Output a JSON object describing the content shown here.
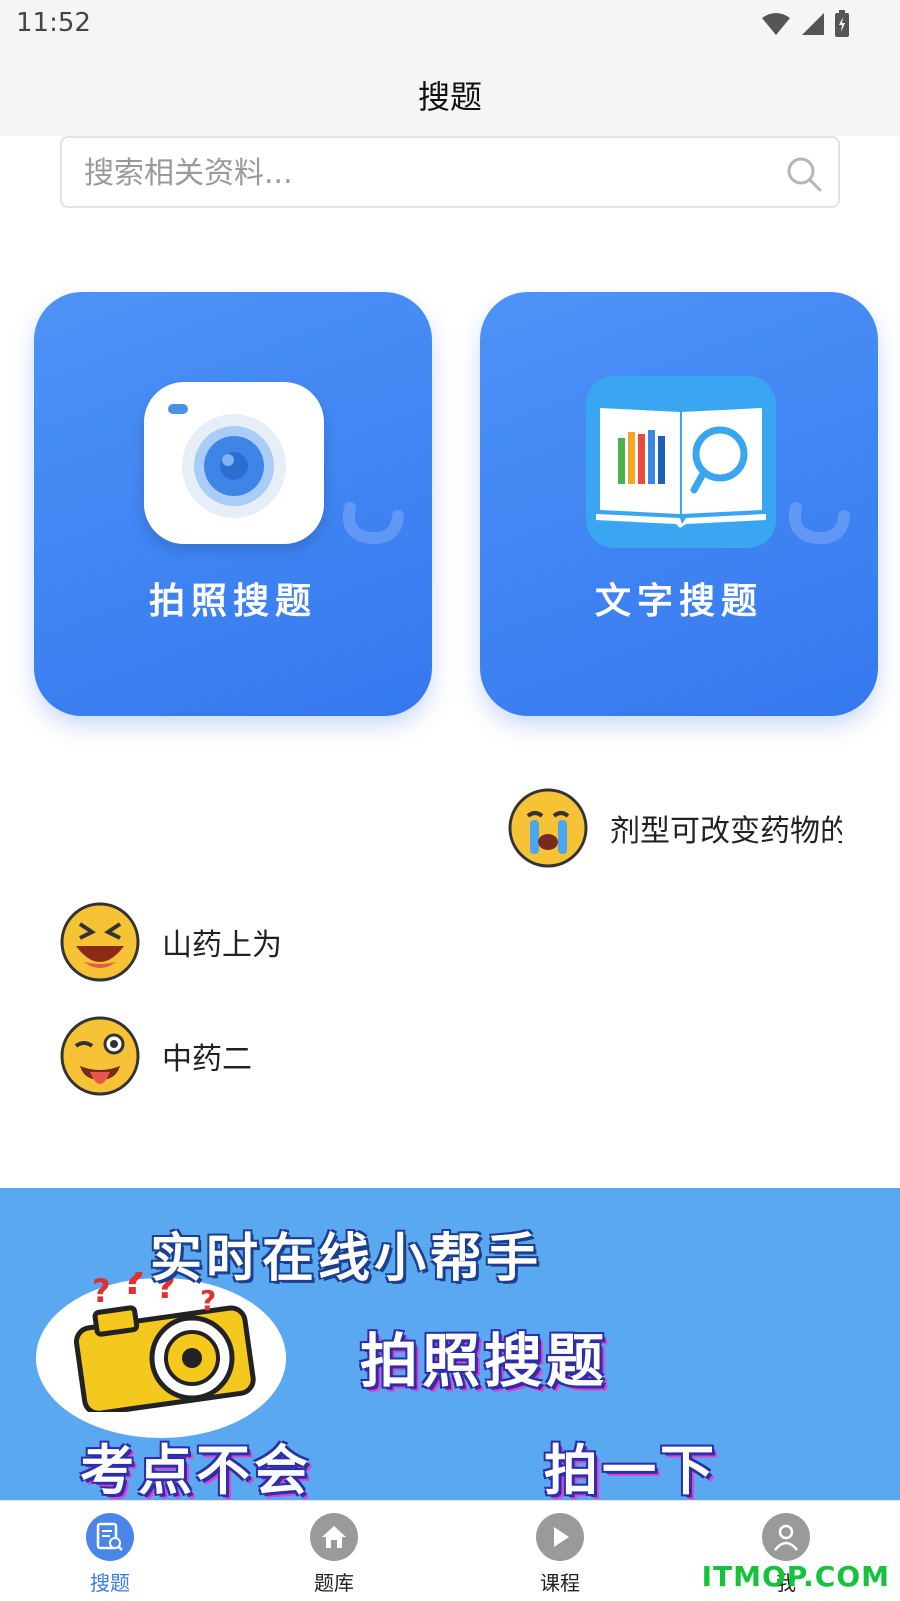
{
  "status": {
    "time": "11:52"
  },
  "topbar": {
    "title": "搜题"
  },
  "search": {
    "placeholder": "搜索相关资料..."
  },
  "cards": {
    "photo": {
      "label": "拍照搜题"
    },
    "text": {
      "label": "文字搜题"
    }
  },
  "feed": [
    {
      "text": "剂型可改变药物的",
      "emoji": "crying-face"
    },
    {
      "text": "山药上为",
      "emoji": "grinning-squint-face"
    },
    {
      "text": "中药二",
      "emoji": "winking-tongue-face"
    }
  ],
  "banner": {
    "line1": "实时在线小帮手",
    "line2": "拍照搜题",
    "line3": "考点不会",
    "line4": "拍一下"
  },
  "tabs": [
    {
      "label": "搜题",
      "icon": "search-doc-icon",
      "active": true
    },
    {
      "label": "题库",
      "icon": "home-icon",
      "active": false
    },
    {
      "label": "课程",
      "icon": "play-icon",
      "active": false
    },
    {
      "label": "我",
      "icon": "user-icon",
      "active": false
    }
  ],
  "watermark": "ITMOP.COM",
  "colors": {
    "accent": "#3a7be6",
    "card": "#3f86f2",
    "banner": "#5aa9f0"
  }
}
